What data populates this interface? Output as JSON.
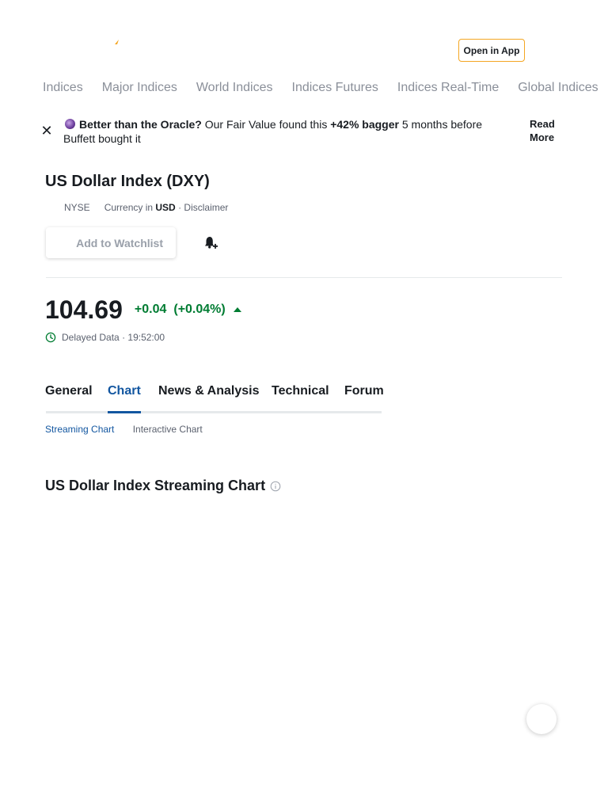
{
  "header": {
    "open_app_label": "Open in App",
    "brand_color": "#f4a622"
  },
  "nav": {
    "items": [
      {
        "label": "Indices"
      },
      {
        "label": "Major Indices"
      },
      {
        "label": "World Indices"
      },
      {
        "label": "Indices Futures"
      },
      {
        "label": "Indices Real-Time"
      },
      {
        "label": "Global Indices"
      }
    ]
  },
  "promo": {
    "close_symbol": "✕",
    "headline": "Better than the Oracle?",
    "text_part1": " Our Fair Value found this ",
    "highlight": "+42% bagger",
    "text_part2": " 5 months before Buffett bought it",
    "read_more": "Read More"
  },
  "instrument": {
    "title": "US Dollar Index (DXY)",
    "exchange": "NYSE",
    "currency_prefix": "Currency in",
    "currency": "USD",
    "disclaimer": "· Disclaimer",
    "watchlist_label": "Add to Watchlist"
  },
  "quote": {
    "price": "104.69",
    "change": "+0.04",
    "change_pct": "(+0.04%)",
    "delayed_label": "Delayed Data",
    "time": "· 19:52:00",
    "positive_color": "#007c32"
  },
  "tabs": {
    "items": [
      {
        "label": "General"
      },
      {
        "label": "Chart"
      },
      {
        "label": "News & Analysis"
      },
      {
        "label": "Technical"
      },
      {
        "label": "Forum"
      }
    ],
    "active": "Chart",
    "accent_color": "#1256a0"
  },
  "subtabs": {
    "streaming": "Streaming Chart",
    "interactive": "Interactive Chart"
  },
  "chart_section": {
    "title": "US Dollar Index Streaming Chart"
  }
}
